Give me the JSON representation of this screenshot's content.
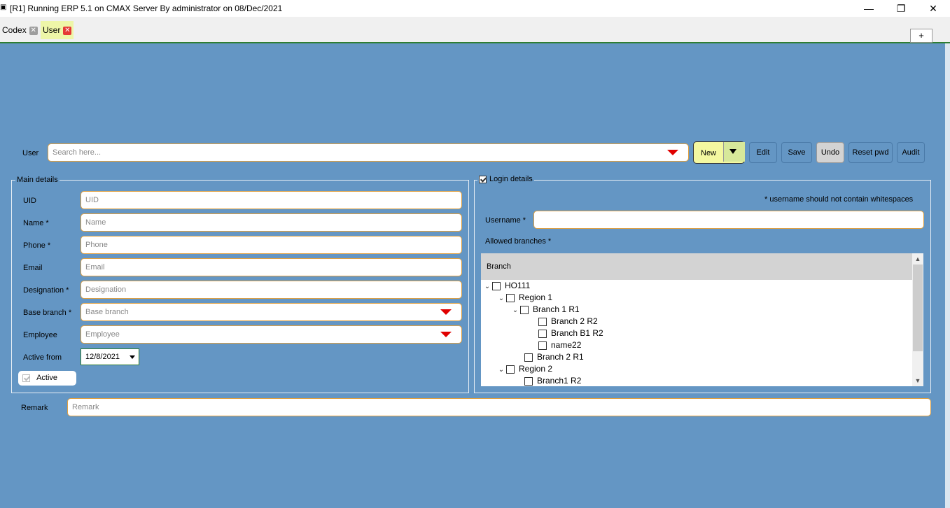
{
  "window": {
    "title": "[R1] Running ERP 5.1 on CMAX Server By administrator on 08/Dec/2021",
    "minimize": "—",
    "maximize": "❐",
    "close": "✕"
  },
  "tabs": [
    {
      "label": "Codex",
      "close": "✕"
    },
    {
      "label": "User",
      "close": "✕"
    }
  ],
  "add_tab": "+",
  "user_search": {
    "label": "User",
    "placeholder": "Search here..."
  },
  "toolbar": {
    "new": "New",
    "edit": "Edit",
    "save": "Save",
    "undo": "Undo",
    "reset_pwd": "Reset pwd",
    "audit": "Audit"
  },
  "main_details": {
    "legend": "Main details",
    "fields": [
      {
        "label": "UID",
        "placeholder": "UID"
      },
      {
        "label": "Name *",
        "placeholder": "Name"
      },
      {
        "label": "Phone *",
        "placeholder": "Phone"
      },
      {
        "label": "Email",
        "placeholder": "Email"
      },
      {
        "label": "Designation *",
        "placeholder": "Designation"
      },
      {
        "label": "Base branch *",
        "placeholder": "Base branch"
      },
      {
        "label": "Employee",
        "placeholder": "Employee"
      }
    ],
    "active_from_label": "Active from",
    "active_from_value": "12/8/2021",
    "active_label": "Active"
  },
  "login_details": {
    "legend": "Login details",
    "note": "*  username should not contain whitespaces",
    "username_label": "Username *",
    "allowed_branches_label": "Allowed branches *",
    "tree_header": "Branch",
    "tree": [
      {
        "label": "HO111",
        "level": 0,
        "expanded": true
      },
      {
        "label": "Region 1",
        "level": 1,
        "expanded": true
      },
      {
        "label": "Branch 1 R1",
        "level": 2,
        "expanded": true
      },
      {
        "label": "Branch 2 R2",
        "level": 3,
        "expanded": null
      },
      {
        "label": "Branch B1 R2",
        "level": 3,
        "expanded": null
      },
      {
        "label": "name22",
        "level": 3,
        "expanded": null
      },
      {
        "label": "Branch 2 R1",
        "level": 2,
        "expanded": null
      },
      {
        "label": "Region 2",
        "level": 1,
        "expanded": true
      },
      {
        "label": "Branch1 R2",
        "level": 2,
        "expanded": null
      }
    ]
  },
  "remark": {
    "label": "Remark",
    "placeholder": "Remark"
  },
  "colors": {
    "background": "#6496c4",
    "field_border": "#e0a040",
    "dropdown_arrow": "#e00000"
  }
}
